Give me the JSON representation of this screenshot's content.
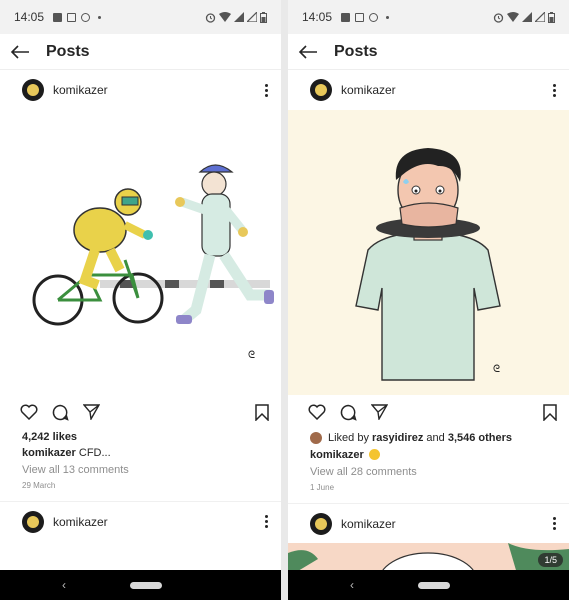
{
  "left": {
    "status": {
      "time": "14:05"
    },
    "appbar": {
      "title": "Posts"
    },
    "post": {
      "username": "komikazer",
      "likes": "4,242 likes",
      "caption_user": "komikazer",
      "caption_text": " CFD...",
      "comments": "View all 13 comments",
      "date": "29 March"
    },
    "next_post": {
      "username": "komikazer"
    }
  },
  "right": {
    "status": {
      "time": "14:05"
    },
    "appbar": {
      "title": "Posts"
    },
    "post": {
      "username": "komikazer",
      "liked_prefix": "Liked by ",
      "liked_user": "rasyidirez",
      "liked_and": " and ",
      "liked_others": "3,546 others",
      "caption_user": "komikazer",
      "comments": "View all 28 comments",
      "date": "1 June"
    },
    "next_post": {
      "username": "komikazer",
      "carousel": "1/5"
    }
  },
  "nav": {
    "back_glyph": "‹"
  },
  "icons": [
    "back-arrow-icon",
    "more-options-icon",
    "heart-icon",
    "comment-icon",
    "share-icon",
    "bookmark-icon",
    "wifi-icon",
    "signal-icon",
    "battery-icon",
    "alarm-icon"
  ]
}
